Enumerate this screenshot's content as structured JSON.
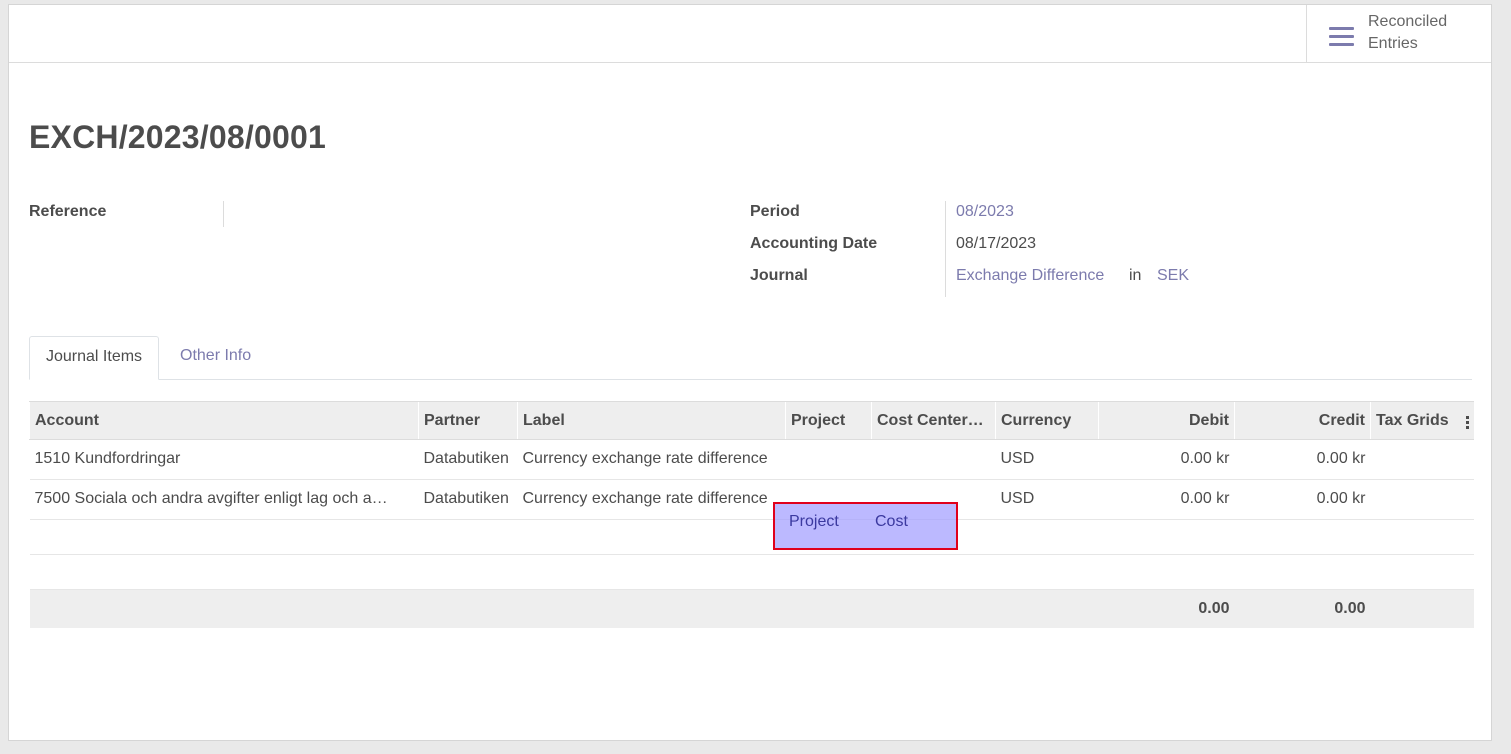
{
  "smart_button": {
    "label_line1": "Reconciled",
    "label_line2": "Entries",
    "icon": "bars-icon"
  },
  "title": "EXCH/2023/08/0001",
  "fields": {
    "reference_label": "Reference",
    "reference_value": "",
    "period_label": "Period",
    "period_value": "08/2023",
    "accounting_date_label": "Accounting Date",
    "accounting_date_value": "08/17/2023",
    "journal_label": "Journal",
    "journal_value": "Exchange Difference",
    "journal_in": "in",
    "journal_currency": "SEK"
  },
  "tabs": [
    {
      "label": "Journal Items",
      "active": true
    },
    {
      "label": "Other Info",
      "active": false
    }
  ],
  "table": {
    "headers": [
      "Account",
      "Partner",
      "Label",
      "Project",
      "Cost Center…",
      "Currency",
      "Debit",
      "Credit",
      "Tax Grids"
    ],
    "rows": [
      {
        "account": "1510 Kundfordringar",
        "partner": "Databutiken",
        "label": "Currency exchange rate difference",
        "project": "",
        "cost_center": "",
        "currency": "USD",
        "debit": "0.00 kr",
        "credit": "0.00 kr",
        "tax_grids": ""
      },
      {
        "account": "7500 Sociala och andra avgifter enligt lag och a…",
        "partner": "Databutiken",
        "label": "Currency exchange rate difference",
        "project": "Project",
        "cost_center": "Cost",
        "currency": "USD",
        "debit": "0.00 kr",
        "credit": "0.00 kr",
        "tax_grids": ""
      }
    ],
    "totals": {
      "debit": "0.00",
      "credit": "0.00"
    }
  },
  "colors": {
    "link": "#7c7bad",
    "highlight_border": "#e0001b",
    "highlight_fill": "#a09bff"
  }
}
